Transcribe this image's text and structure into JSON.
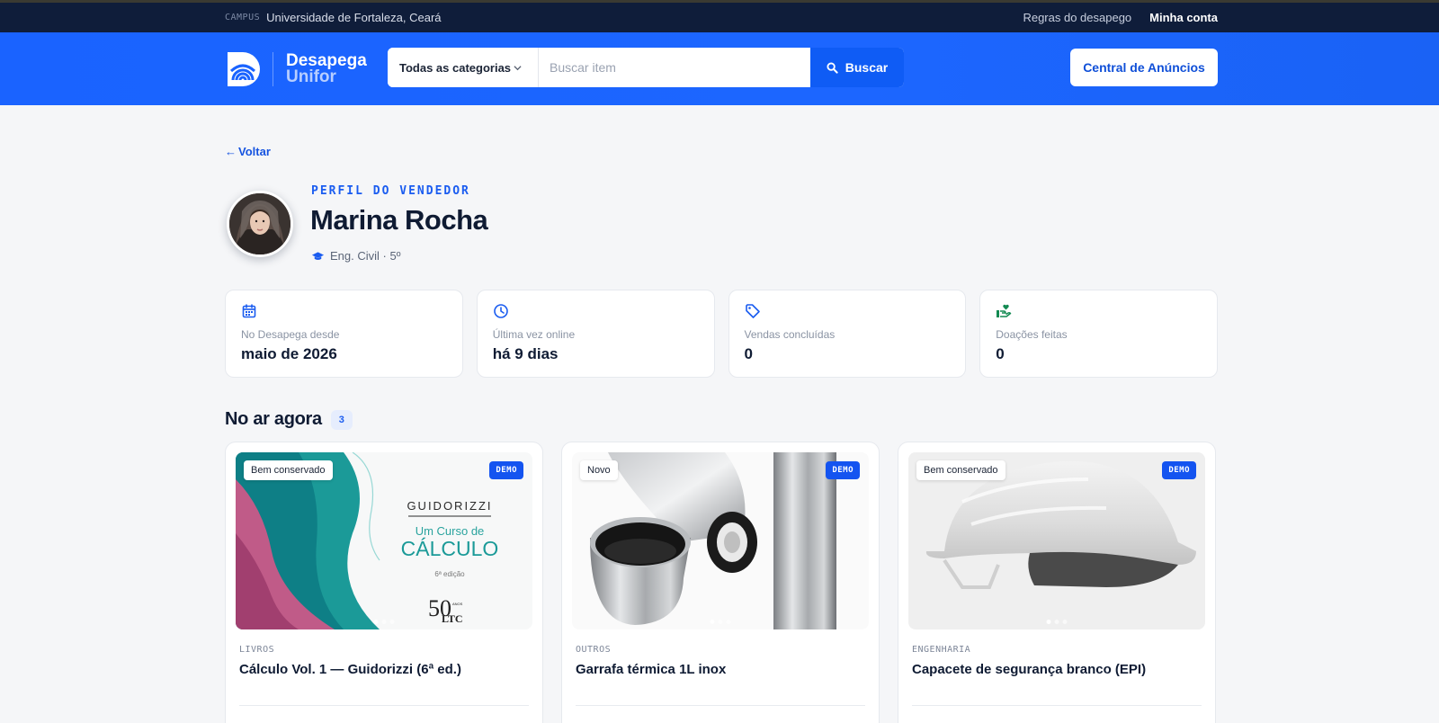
{
  "topbar": {
    "campus_tag": "CAMPUS",
    "campus_name": "Universidade de Fortaleza, Ceará",
    "rules_link": "Regras do desapego",
    "account_link": "Minha conta"
  },
  "header": {
    "logo_line1": "Desapega",
    "logo_line2": "Unifor",
    "category_select": "Todas as categorias",
    "search_placeholder": "Buscar item",
    "search_button": "Buscar",
    "central_button": "Central de Anúncios"
  },
  "profile": {
    "back_label": "Voltar",
    "eyebrow": "PERFIL DO VENDEDOR",
    "name": "Marina Rocha",
    "course": "Eng. Civil · 5º"
  },
  "stats": [
    {
      "label": "No Desapega desde",
      "value": "maio de 2026",
      "icon": "calendar-icon"
    },
    {
      "label": "Última vez online",
      "value": "há 9 dias",
      "icon": "clock-icon"
    },
    {
      "label": "Vendas concluídas",
      "value": "0",
      "icon": "tag-icon"
    },
    {
      "label": "Doações feitas",
      "value": "0",
      "icon": "donation-icon"
    }
  ],
  "listings": {
    "title": "No ar agora",
    "count": "3",
    "items": [
      {
        "condition": "Bem conservado",
        "demo": "DEMO",
        "category": "LIVROS",
        "title": "Cálculo Vol. 1 — Guidorizzi (6ª ed.)",
        "cover": {
          "author": "GUIDORIZZI",
          "subtitle": "Um Curso de",
          "main": "CÁLCULO",
          "edition": "6ª edição",
          "seal_number": "50",
          "seal_small": "ANOS",
          "publisher": "LTC"
        }
      },
      {
        "condition": "Novo",
        "demo": "DEMO",
        "category": "OUTROS",
        "title": "Garrafa térmica 1L inox"
      },
      {
        "condition": "Bem conservado",
        "demo": "DEMO",
        "category": "ENGENHARIA",
        "title": "Capacete de segurança branco (EPI)"
      }
    ]
  },
  "colors": {
    "brand": "#1a63ff",
    "navy": "#0f1d3a",
    "accent_green": "#138a52"
  }
}
